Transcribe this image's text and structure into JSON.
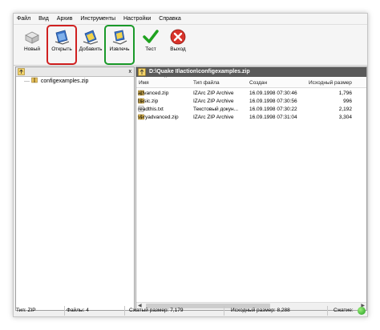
{
  "menu": [
    "Файл",
    "Вид",
    "Архив",
    "Инструменты",
    "Настройки",
    "Справка"
  ],
  "toolbar": {
    "new_label": "Новый",
    "open_label": "Открыть",
    "add_label": "Добавить",
    "extract_label": "Извлечь",
    "test_label": "Тест",
    "exit_label": "Выход"
  },
  "left_pane": {
    "close_glyph": "x",
    "tree_item": "configexamples.zip"
  },
  "path": "D:\\Quake II\\action\\configexamples.zip",
  "columns": [
    "Имя",
    "Тип файла",
    "Создан",
    "Исходный размер"
  ],
  "files": [
    {
      "name": "advanced.zip",
      "type": "IZArc ZIP Archive",
      "created": "16.09.1998 07:30:46",
      "size": "1,796",
      "icon": "zip-icon"
    },
    {
      "name": "basic.zip",
      "type": "IZArc ZIP Archive",
      "created": "16.09.1998 07:30:56",
      "size": "996",
      "icon": "zip-icon"
    },
    {
      "name": "readthis.txt",
      "type": "Текстовый докун...",
      "created": "16.09.1998 07:30:22",
      "size": "2,192",
      "icon": "text-file-icon"
    },
    {
      "name": "veryadvanced.zip",
      "type": "IZArc ZIP Archive",
      "created": "16.09.1998 07:31:04",
      "size": "3,304",
      "icon": "zip-icon"
    }
  ],
  "status": {
    "type": "Тип: ZIP",
    "files": "Файлы: 4",
    "compressed": "Сжатый размер: 7,179",
    "original": "Исходный размер: 8,288",
    "compression": "Сжатие:"
  }
}
